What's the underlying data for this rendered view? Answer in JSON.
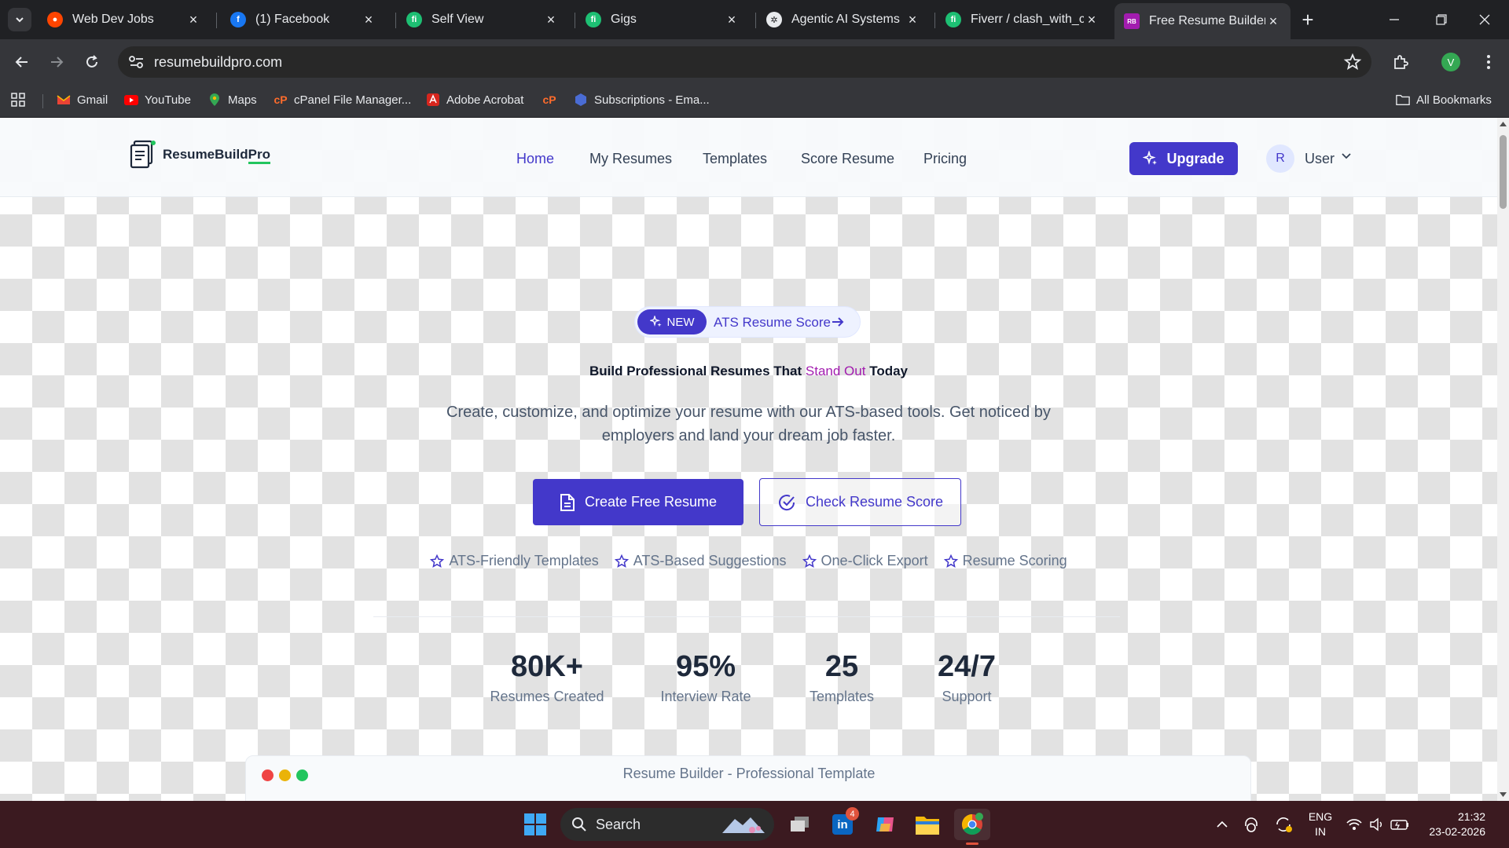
{
  "browser": {
    "tabs": [
      {
        "title": "Web Dev Jobs",
        "icon": "reddit-icon",
        "color": "#ff4500"
      },
      {
        "title": "(1) Facebook",
        "icon": "facebook-icon",
        "color": "#1877f2"
      },
      {
        "title": "Self View",
        "icon": "fiverr-icon",
        "color": "#1dbf73"
      },
      {
        "title": "Gigs",
        "icon": "fiverr-icon",
        "color": "#1dbf73"
      },
      {
        "title": "Agentic AI Systems",
        "icon": "openai-icon",
        "color": "#e8eaed"
      },
      {
        "title": "Fiverr / clash_with_ca",
        "icon": "fiverr-icon",
        "color": "#1dbf73"
      },
      {
        "title": "Free Resume Builder",
        "icon": "resumebuildpro-icon",
        "color": "#a21caf",
        "active": true
      }
    ],
    "url": "resumebuildpro.com",
    "profile_initial": "V",
    "bookmarks": [
      {
        "label": "Gmail",
        "icon": "gmail-icon"
      },
      {
        "label": "YouTube",
        "icon": "youtube-icon"
      },
      {
        "label": "Maps",
        "icon": "maps-icon"
      },
      {
        "label": "cPanel File Manager...",
        "icon": "cpanel-icon"
      },
      {
        "label": "Adobe Acrobat",
        "icon": "acrobat-icon"
      },
      {
        "label": "",
        "icon": "cpanel-icon"
      },
      {
        "label": "Subscriptions - Ema...",
        "icon": "subscriptions-icon"
      }
    ],
    "all_bookmarks": "All Bookmarks"
  },
  "header": {
    "logo_text": "ResumeBuild",
    "logo_pro": "Pro",
    "nav": [
      "Home",
      "My Resumes",
      "Templates",
      "Score Resume",
      "Pricing"
    ],
    "active_nav": "Home",
    "upgrade_label": "Upgrade",
    "avatar_initial": "R",
    "user_label": "User"
  },
  "hero": {
    "badge_new": "NEW",
    "badge_text": "ATS Resume Score",
    "headline_start": "Build Professional Resumes That ",
    "headline_accent": "Stand Out",
    "headline_end": " Today",
    "subtitle": "Create, customize, and optimize your resume with our ATS-based tools. Get noticed by employers and land your dream job faster.",
    "primary_cta": "Create Free Resume",
    "secondary_cta": "Check Resume Score",
    "features": [
      "ATS-Friendly Templates",
      "ATS-Based Suggestions",
      "One-Click Export",
      "Resume Scoring"
    ]
  },
  "stats": [
    {
      "value": "80K+",
      "label": "Resumes Created"
    },
    {
      "value": "95%",
      "label": "Interview Rate"
    },
    {
      "value": "25",
      "label": "Templates"
    },
    {
      "value": "24/7",
      "label": "Support"
    }
  ],
  "preview": {
    "title": "Resume Builder - Professional Template"
  },
  "taskbar": {
    "search_label": "Search",
    "linkedin_badge": "4",
    "language": "ENG",
    "region": "IN",
    "time": "21:32",
    "date": "23-02-2026"
  },
  "colors": {
    "brand": "#4338ca",
    "accent": "#a21caf",
    "logo_underline": "#22c55e"
  }
}
